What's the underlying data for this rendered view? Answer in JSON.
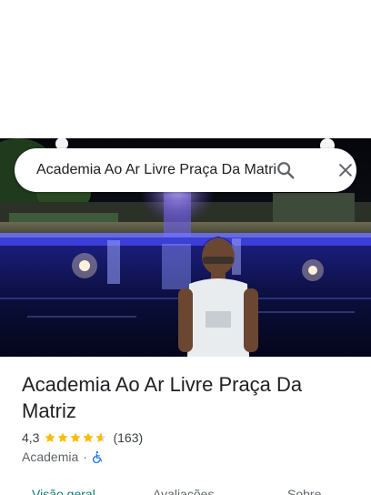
{
  "search": {
    "query": "Academia Ao Ar Livre Praça Da Matri"
  },
  "place": {
    "name": "Academia Ao Ar Livre Praça Da Matriz",
    "rating": "4,3",
    "rating_stars": 4.3,
    "review_count": "(163)",
    "category": "Academia",
    "separator": "·"
  },
  "tabs": [
    {
      "label": "Visão geral"
    },
    {
      "label": "Avaliações"
    },
    {
      "label": "Sobre"
    }
  ],
  "colors": {
    "accent": "#0b7a6f",
    "star": "#fbbc04",
    "accessibility": "#1a73e8"
  },
  "icons": [
    "search-icon",
    "close-icon",
    "star-icon",
    "wheelchair-icon"
  ]
}
